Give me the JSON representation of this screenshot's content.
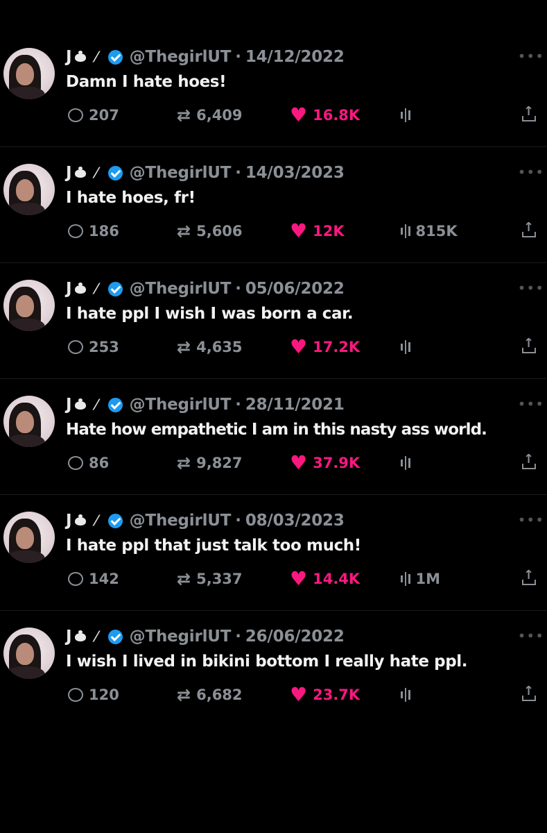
{
  "tweets": [
    {
      "name": "J",
      "handle": "@ThegirlUT",
      "date": "14/12/2022",
      "text": "Damn I hate hoes!",
      "replies": "207",
      "retweets": "6,409",
      "likes": "16.8K",
      "views": ""
    },
    {
      "name": "J",
      "handle": "@ThegirlUT",
      "date": "14/03/2023",
      "text": "I hate hoes, fr!",
      "replies": "186",
      "retweets": "5,606",
      "likes": "12K",
      "views": "815K"
    },
    {
      "name": "J",
      "handle": "@ThegirlUT",
      "date": "05/06/2022",
      "text": "I hate ppl I wish I was born a car.",
      "replies": "253",
      "retweets": "4,635",
      "likes": "17.2K",
      "views": ""
    },
    {
      "name": "J",
      "handle": "@ThegirlUT",
      "date": "28/11/2021",
      "text": "Hate how empathetic I am in this nasty ass world.",
      "replies": "86",
      "retweets": "9,827",
      "likes": "37.9K",
      "views": ""
    },
    {
      "name": "J",
      "handle": "@ThegirlUT",
      "date": "08/03/2023",
      "text": "I hate ppl that just talk too much!",
      "replies": "142",
      "retweets": "5,337",
      "likes": "14.4K",
      "views": "1M"
    },
    {
      "name": "J",
      "handle": "@ThegirlUT",
      "date": "26/06/2022",
      "text": "I wish I lived in bikini bottom I really hate ppl.",
      "replies": "120",
      "retweets": "6,682",
      "likes": "23.7K",
      "views": ""
    }
  ],
  "colors": {
    "like": "#f91880",
    "verified": "#1d9bf0",
    "muted": "#8b9096"
  },
  "icons": [
    "reply-icon",
    "retweet-icon",
    "heart-icon",
    "views-icon",
    "share-icon",
    "verified-icon",
    "more-icon"
  ]
}
